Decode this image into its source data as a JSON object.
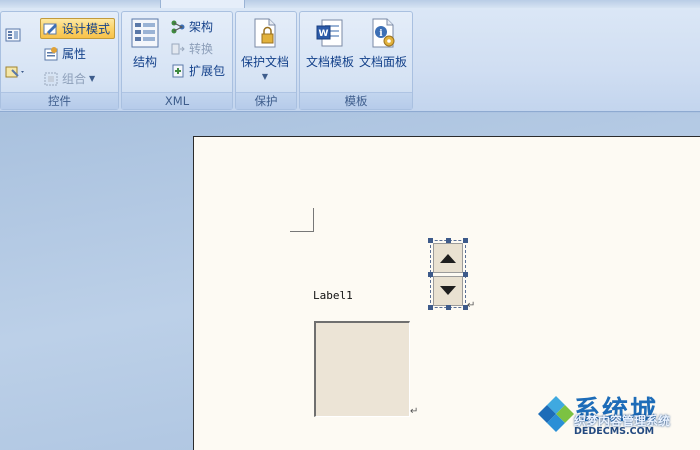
{
  "ribbon": {
    "groups": {
      "controls": {
        "label": "控件",
        "design_mode_label": "设计模式",
        "properties_label": "属性",
        "group_label": "组合"
      },
      "xml": {
        "label": "XML",
        "structure_label": "结构",
        "schema_label": "架构",
        "transform_label": "转换",
        "expansion_pack_label": "扩展包"
      },
      "protect": {
        "label": "保护",
        "protect_document_label": "保护文档"
      },
      "templates": {
        "label": "模板",
        "document_template_label": "文档模板",
        "document_panel_label": "文档面板"
      }
    }
  },
  "document": {
    "label_control_text": "Label1",
    "paragraph_mark": "↵"
  },
  "watermark": {
    "logo_text": "系统城",
    "line1": "织梦内容管理系统",
    "line2": "DEDECMS.COM"
  },
  "colors": {
    "ribbon_text": "#15428b",
    "active_button": "#fbd36a",
    "page_background": "#fdfaf3"
  }
}
